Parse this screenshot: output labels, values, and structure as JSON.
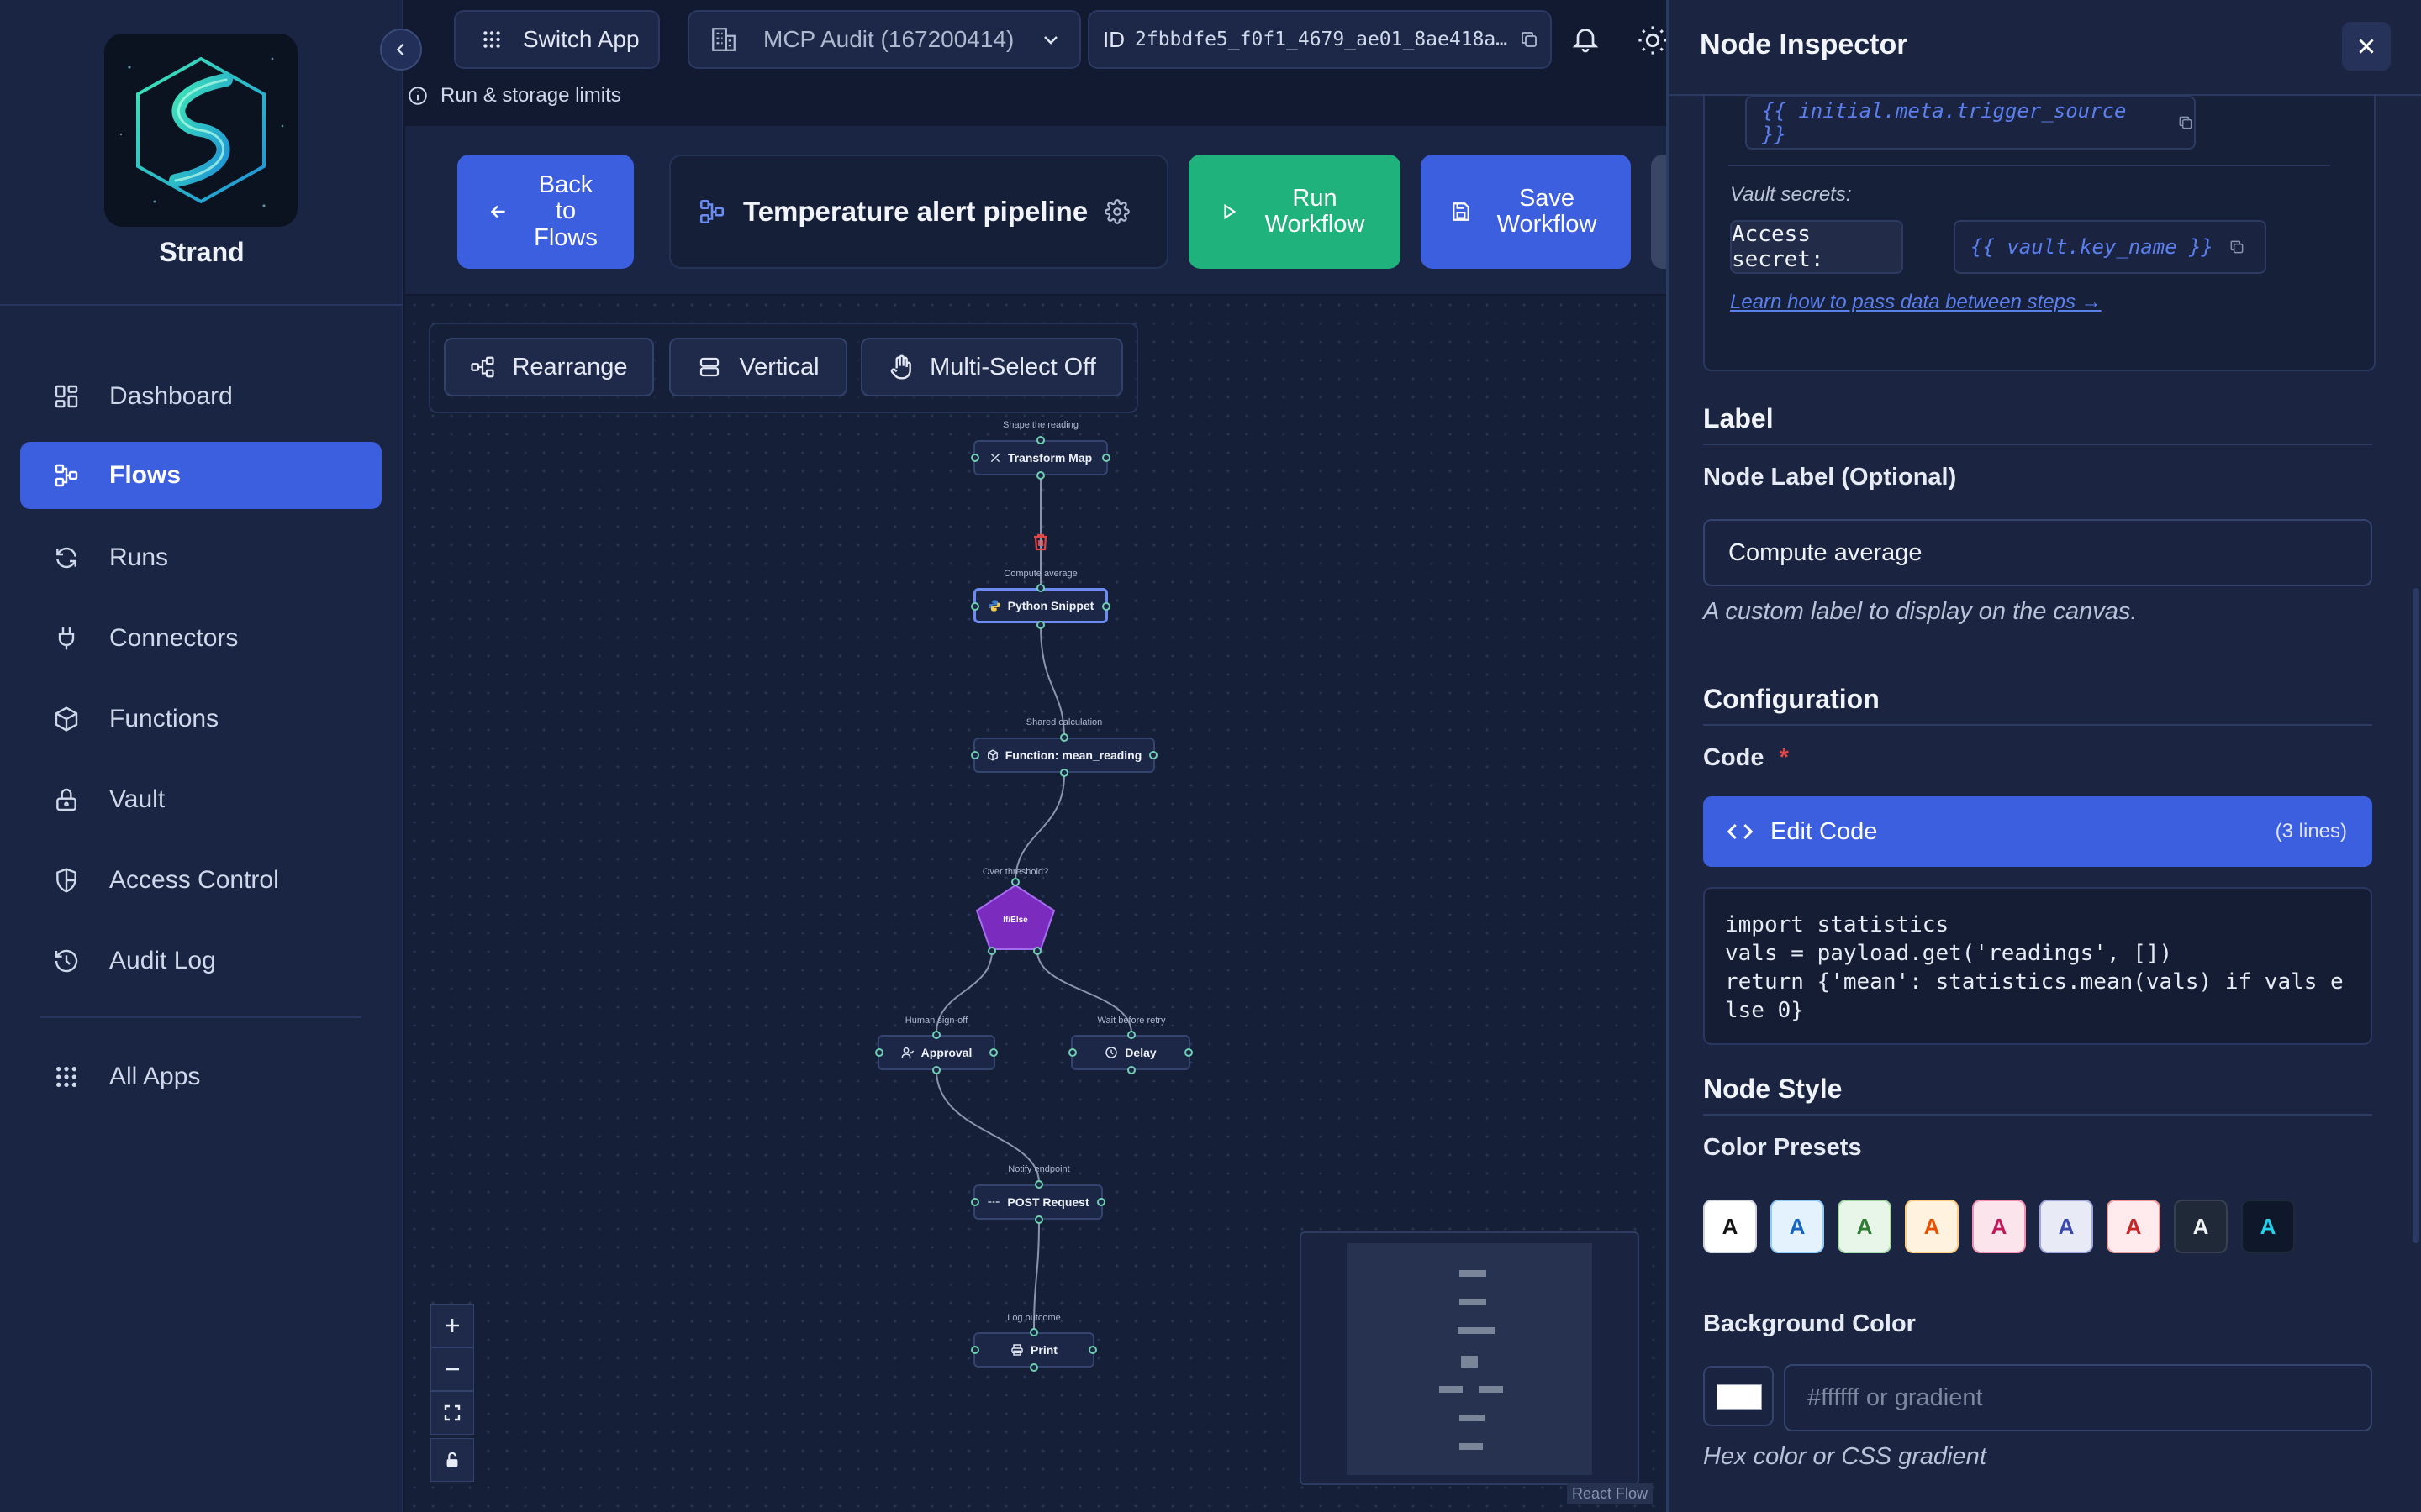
{
  "sidebar": {
    "brand": "Strand",
    "items": [
      {
        "label": "Dashboard",
        "icon": "dashboard-icon"
      },
      {
        "label": "Flows",
        "icon": "flows-icon",
        "active": true
      },
      {
        "label": "Runs",
        "icon": "runs-icon"
      },
      {
        "label": "Connectors",
        "icon": "plug-icon"
      },
      {
        "label": "Functions",
        "icon": "cube-icon"
      },
      {
        "label": "Vault",
        "icon": "lock-icon"
      },
      {
        "label": "Access Control",
        "icon": "shield-icon"
      },
      {
        "label": "Audit Log",
        "icon": "history-icon"
      }
    ],
    "all_apps": "All Apps"
  },
  "topbar": {
    "switch_app": "Switch App",
    "org": "MCP Audit (167200414)",
    "id_label": "ID",
    "id_value": "2fbbdfe5_f0f1_4679_ae01_8ae418a…",
    "limits": "Run & storage limits"
  },
  "header": {
    "back": "Back to Flows",
    "flow_name": "Temperature alert pipeline",
    "run": "Run Workflow",
    "save": "Save Workflow"
  },
  "toolbar": {
    "rearrange": "Rearrange",
    "vertical": "Vertical",
    "multiselect": "Multi-Select Off"
  },
  "nodes": [
    {
      "label": "Shape the reading",
      "title": "Transform Map"
    },
    {
      "label": "Compute average",
      "title": "Python Snippet"
    },
    {
      "label": "Shared calculation",
      "title": "Function: mean_reading"
    },
    {
      "label": "Over threshold?",
      "title": "If/Else"
    },
    {
      "label": "Human sign-off",
      "title": "Approval"
    },
    {
      "label": "Wait before retry",
      "title": "Delay"
    },
    {
      "label": "Notify endpoint",
      "title": "POST Request"
    },
    {
      "label": "Log outcome",
      "title": "Print"
    }
  ],
  "attribution": "React Flow",
  "inspector": {
    "title": "Node Inspector",
    "trigger_chip": "{{ initial.meta.trigger_source }}",
    "vault_label": "Vault secrets:",
    "access_secret": "Access secret:",
    "vault_chip": "{{ vault.key_name }}",
    "learn_link": "Learn how to pass data between steps →",
    "label_section": "Label",
    "node_label_title": "Node Label (Optional)",
    "node_label_value": "Compute average",
    "node_label_help": "A custom label to display on the canvas.",
    "config_section": "Configuration",
    "code_label": "Code",
    "required_mark": "*",
    "edit_code": "Edit Code",
    "lines": "(3 lines)",
    "code": "import statistics\nvals = payload.get('readings', [])\nreturn {'mean': statistics.mean(vals) if vals e\nlse 0}",
    "style_section": "Node Style",
    "presets_label": "Color Presets",
    "preset_letter": "A",
    "presets": [
      {
        "bg": "#ffffff",
        "fg": "#111111",
        "border": "#d0d4dc"
      },
      {
        "bg": "#e3f2fd",
        "fg": "#1565c0",
        "border": "#90caf9"
      },
      {
        "bg": "#e8f5e9",
        "fg": "#2e7d32",
        "border": "#a5d6a7"
      },
      {
        "bg": "#fff3e0",
        "fg": "#e65100",
        "border": "#ffcc80"
      },
      {
        "bg": "#fce4ec",
        "fg": "#c2185b",
        "border": "#f48fb1"
      },
      {
        "bg": "#e8eaf6",
        "fg": "#3949ab",
        "border": "#9fa8da"
      },
      {
        "bg": "#ffebee",
        "fg": "#c62828",
        "border": "#ef9a9a"
      },
      {
        "bg": "#1f2937",
        "fg": "#f3f4f6",
        "border": "#374151"
      },
      {
        "bg": "#0f172a",
        "fg": "#22d3ee",
        "border": "#1e293b"
      }
    ],
    "bg_label": "Background Color",
    "bg_placeholder": "#ffffff or gradient",
    "bg_help": "Hex color or CSS gradient"
  },
  "colors": {
    "accent": "#3c5fe0",
    "run": "#1fb27d",
    "ifelse": "#7b2cbf",
    "danger": "#e04848"
  }
}
